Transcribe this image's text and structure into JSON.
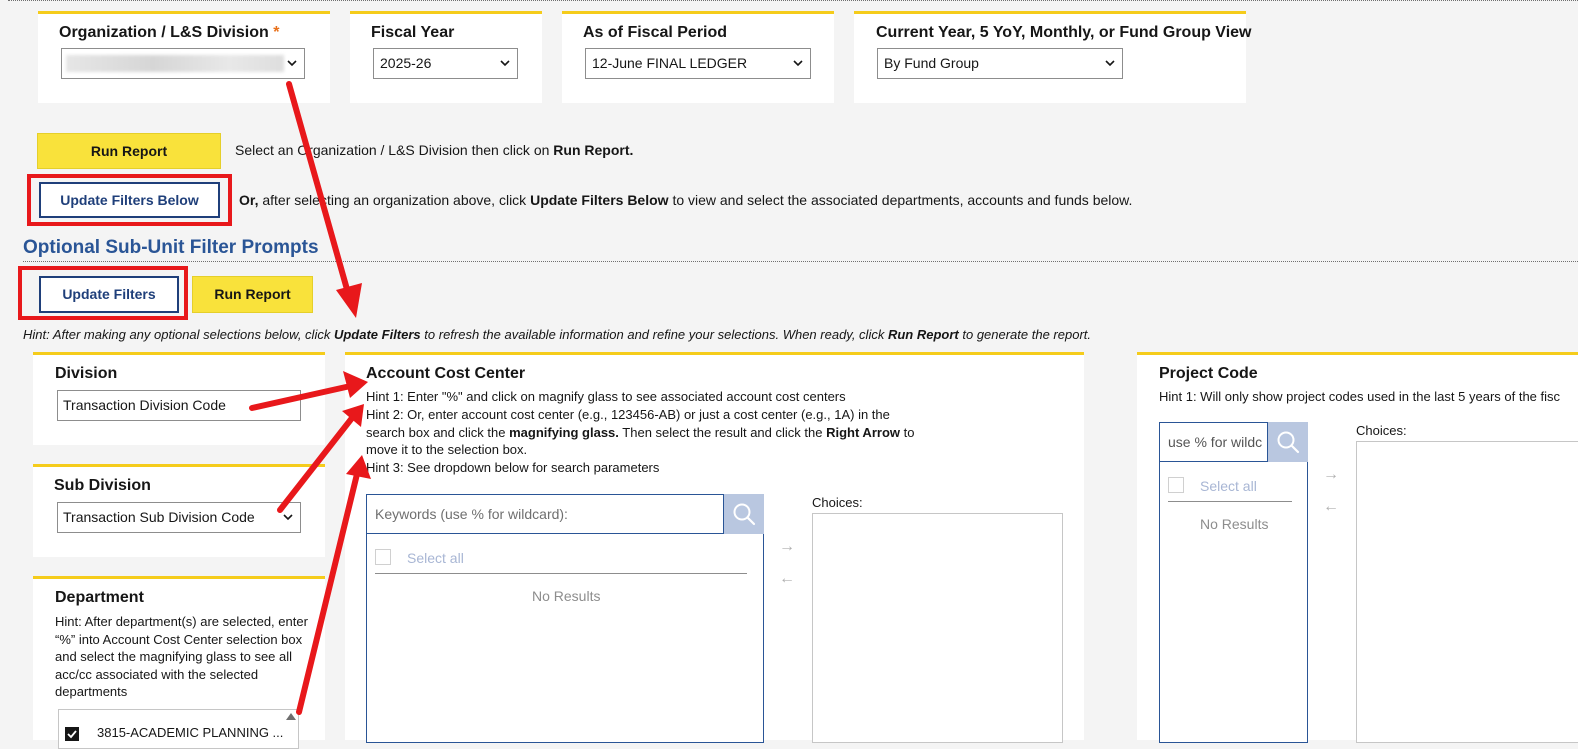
{
  "filters": {
    "organization": {
      "label": "Organization / L&S Division",
      "required_mark": "*"
    },
    "fiscal_year": {
      "label": "Fiscal Year",
      "value": "2025-26"
    },
    "fiscal_period": {
      "label": "As of Fiscal Period",
      "value": "12-June FINAL LEDGER"
    },
    "view": {
      "label": "Current Year, 5 YoY, Monthly, or Fund Group View",
      "value": "By Fund Group"
    }
  },
  "actions": {
    "run_report_label": "Run Report",
    "run_hint_prefix": "Select an Organization / L&S Division then click on",
    "run_hint_bold": "Run Report.",
    "update_filters_below_label": "Update Filters Below",
    "update_hint_lead": "Or,",
    "update_hint_part1": "after selecting an organization above, click",
    "update_hint_bold": "Update Filters Below",
    "update_hint_part2": "to view and select the associated departments, accounts and funds below."
  },
  "optional": {
    "title": "Optional Sub-Unit Filter Prompts",
    "update_filters_label": "Update Filters",
    "run_report_label": "Run Report",
    "hint_1": "Hint:  After making any optional selections below, click",
    "hint_b1": "Update Filters",
    "hint_2": "to refresh the available information and refine your selections.  When ready, click",
    "hint_b2": "Run Report",
    "hint_3": "to generate the report."
  },
  "division": {
    "title": "Division",
    "value": "Transaction Division Code"
  },
  "sub_division": {
    "title": "Sub Division",
    "value": "Transaction Sub Division Code"
  },
  "department": {
    "title": "Department",
    "hint": "Hint:  After department(s) are selected, enter “%” into Account Cost Center selection box and select the magnifying glass to see all acc/cc associated with the selected departments",
    "first_item": "3815-ACADEMIC PLANNING ..."
  },
  "account_cost_center": {
    "title": "Account Cost Center",
    "hint1": "Hint 1: Enter \"%\" and click on magnify glass to see associated account cost centers",
    "hint2_a": "Hint 2: Or, enter account cost center (e.g., 123456-AB) or just a cost center (e.g., 1A) in the search box and click the",
    "hint2_b1": "magnifying glass.",
    "hint2_c": "Then select the result and click the",
    "hint2_b2": "Right Arrow",
    "hint2_d": "to move it to the selection box.",
    "hint3": "Hint 3: See dropdown below for search parameters",
    "placeholder": "Keywords (use % for wildcard):",
    "select_all": "Select all",
    "no_results": "No Results",
    "choices_label": "Choices:"
  },
  "project_code": {
    "title": "Project Code",
    "hint1": "Hint 1: Will only show project codes used in the last 5 years of the fisc",
    "placeholder": "use % for wildc",
    "select_all": "Select all",
    "no_results": "No Results",
    "choices_label": "Choices:"
  },
  "colors": {
    "accent_yellow": "#f5cc1b",
    "button_yellow": "#f9e23b",
    "navy": "#1f3f7a",
    "annotation_red": "#e8181b"
  }
}
